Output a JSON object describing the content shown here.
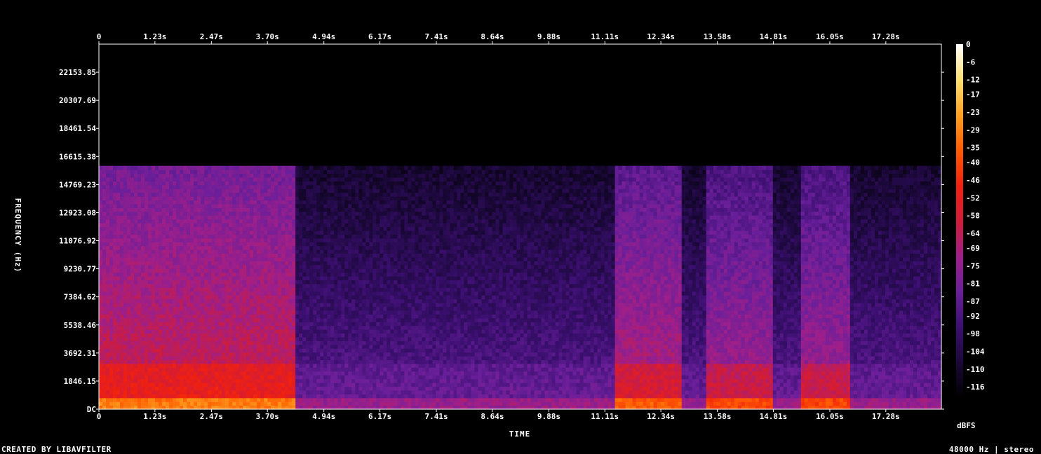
{
  "chart_data": {
    "type": "heatmap",
    "title": "",
    "xlabel": "TIME",
    "ylabel": "FREQUENCY (Hz)",
    "colorbar_label": "dBFS",
    "x_ticks": [
      "0",
      "1.23s",
      "2.47s",
      "3.70s",
      "4.94s",
      "6.17s",
      "7.41s",
      "8.64s",
      "9.88s",
      "11.11s",
      "12.34s",
      "13.58s",
      "14.81s",
      "16.05s",
      "17.28s"
    ],
    "x_tick_values": [
      0,
      1.23,
      2.47,
      3.7,
      4.94,
      6.17,
      7.41,
      8.64,
      9.88,
      11.11,
      12.34,
      13.58,
      14.81,
      16.05,
      17.28
    ],
    "xlim": [
      0,
      18.5
    ],
    "y_ticks": [
      "DC",
      "1846.15",
      "3692.31",
      "5538.46",
      "7384.62",
      "9230.77",
      "11076.92",
      "12923.08",
      "14769.23",
      "16615.38",
      "18461.54",
      "20307.69",
      "22153.85"
    ],
    "y_tick_values": [
      0,
      1846.15,
      3692.31,
      5538.46,
      7384.62,
      9230.77,
      11076.92,
      12923.08,
      14769.23,
      16615.38,
      18461.54,
      20307.69,
      22153.85
    ],
    "ylim": [
      0,
      24000
    ],
    "colorbar_ticks": [
      "0",
      "-6",
      "-12",
      "-17",
      "-23",
      "-29",
      "-35",
      "-40",
      "-46",
      "-52",
      "-58",
      "-64",
      "-69",
      "-75",
      "-81",
      "-87",
      "-92",
      "-98",
      "-104",
      "-110",
      "-116"
    ],
    "colorbar_values": [
      0,
      -6,
      -12,
      -17,
      -23,
      -29,
      -35,
      -40,
      -46,
      -52,
      -58,
      -64,
      -69,
      -75,
      -81,
      -87,
      -92,
      -98,
      -104,
      -110,
      -116
    ],
    "colorbar_range": [
      -120,
      0
    ],
    "colormap": [
      "#000000",
      "#1a0838",
      "#3b0f70",
      "#6a1f9a",
      "#9e1f8a",
      "#d01c3a",
      "#f02010",
      "#ff5a00",
      "#ffa020",
      "#ffe070",
      "#ffffff"
    ],
    "content_cutoff_hz": 16000,
    "loud_time_regions": [
      {
        "start": 0.0,
        "end": 4.3,
        "level": -60
      },
      {
        "start": 11.3,
        "end": 12.8,
        "level": -66
      },
      {
        "start": 13.3,
        "end": 14.8,
        "level": -70
      },
      {
        "start": 15.4,
        "end": 16.5,
        "level": -70
      }
    ],
    "grid": false,
    "legend": "none"
  },
  "footer": {
    "left": "CREATED BY LIBAVFILTER",
    "right": "48000 Hz | stereo"
  }
}
